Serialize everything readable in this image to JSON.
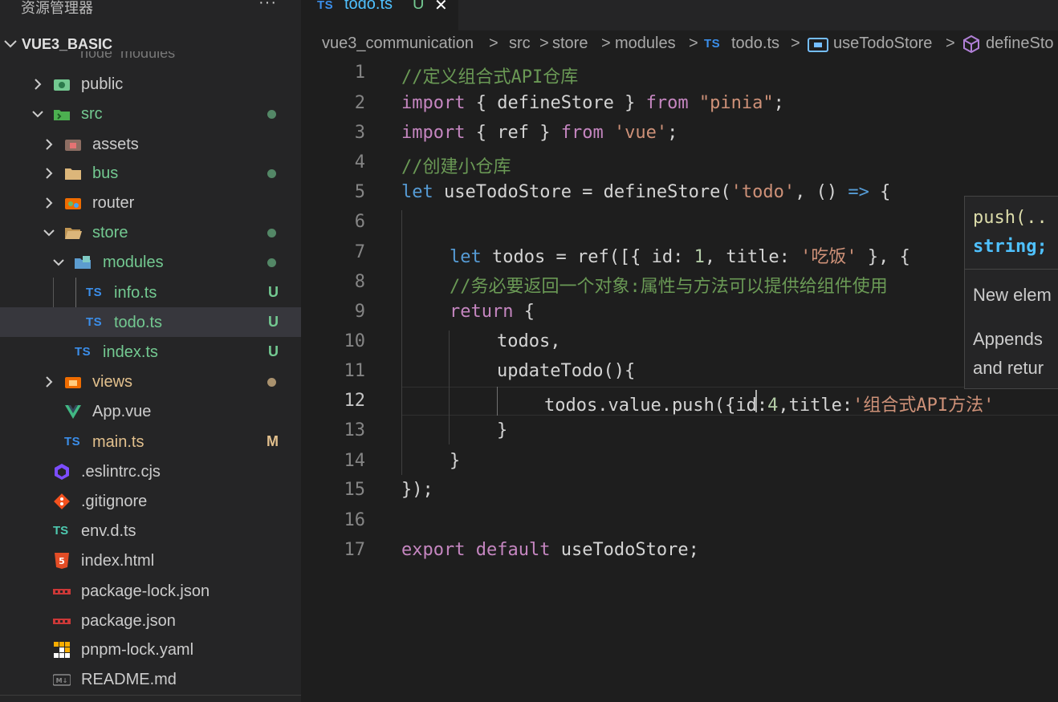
{
  "sidebar": {
    "title": "资源管理器",
    "more": "···",
    "section": "VUE3_BASIC",
    "ghost_item": "node_modules",
    "items": [
      {
        "name": "public",
        "status": ""
      },
      {
        "name": "src",
        "status": ""
      },
      {
        "name": "assets",
        "status": ""
      },
      {
        "name": "bus",
        "status": ""
      },
      {
        "name": "router",
        "status": ""
      },
      {
        "name": "store",
        "status": ""
      },
      {
        "name": "modules",
        "status": ""
      },
      {
        "name": "info.ts",
        "status": "U"
      },
      {
        "name": "todo.ts",
        "status": "U"
      },
      {
        "name": "index.ts",
        "status": "U"
      },
      {
        "name": "views",
        "status": ""
      },
      {
        "name": "App.vue",
        "status": ""
      },
      {
        "name": "main.ts",
        "status": "M"
      },
      {
        "name": ".eslintrc.cjs",
        "status": ""
      },
      {
        "name": ".gitignore",
        "status": ""
      },
      {
        "name": "env.d.ts",
        "status": ""
      },
      {
        "name": "index.html",
        "status": ""
      },
      {
        "name": "package-lock.json",
        "status": ""
      },
      {
        "name": "package.json",
        "status": ""
      },
      {
        "name": "pnpm-lock.yaml",
        "status": ""
      },
      {
        "name": "README.md",
        "status": ""
      }
    ],
    "colors": {
      "modified": "#e2c08d",
      "untracked": "#73c991",
      "folder_green": "#73c991"
    }
  },
  "tab": {
    "badge": "TS",
    "name": "todo.ts",
    "status": "U",
    "close": "✕"
  },
  "breadcrumb": {
    "parts": [
      "vue3_communication",
      "src",
      "store",
      "modules",
      "todo.ts",
      "useTodoStore",
      "defineSto"
    ],
    "sep": ">",
    "ts_badge": "TS"
  },
  "code": {
    "line_numbers": [
      "1",
      "2",
      "3",
      "4",
      "5",
      "6",
      "7",
      "8",
      "9",
      "10",
      "11",
      "12",
      "13",
      "14",
      "15",
      "16",
      "17"
    ],
    "current_line": "12",
    "l1": "//定义组合式API仓库",
    "l2": {
      "kw": "import",
      "a": " { defineStore } ",
      "from": "from",
      "str": "\"pinia\"",
      "end": ";"
    },
    "l3": {
      "kw": "import",
      "a": " { ref } ",
      "from": "from",
      "str": "'vue'",
      "end": ";"
    },
    "l4": "//创建小仓库",
    "l5": {
      "kw": "let",
      "a": " useTodoStore = defineStore(",
      "str": "'todo'",
      "b": ", () ",
      "arrow": "=>",
      "c": " {"
    },
    "l7": {
      "kw": "let",
      "a": " todos = ref([{ id: ",
      "num": "1",
      "b": ", title: ",
      "str": "'吃饭'",
      "c": " }, {"
    },
    "l8": "//务必要返回一个对象:属性与方法可以提供给组件使用",
    "l9": {
      "kw": "return",
      "a": " {"
    },
    "l10": "todos,",
    "l11": "updateTodo(){",
    "l12": {
      "a": "todos.value.push({id:",
      "num": "4",
      "b": ",title:",
      "str": "'组合式API方法'"
    },
    "l13": "}",
    "l14": "}",
    "l15": "});",
    "l17": {
      "kw": "export",
      "kw2": "default",
      "a": " useTodoStore;"
    }
  },
  "hover": {
    "signature": "push(..",
    "type": "string;",
    "doc1": "New elem",
    "doc2a": "Appends",
    "doc2b": "and retur"
  }
}
